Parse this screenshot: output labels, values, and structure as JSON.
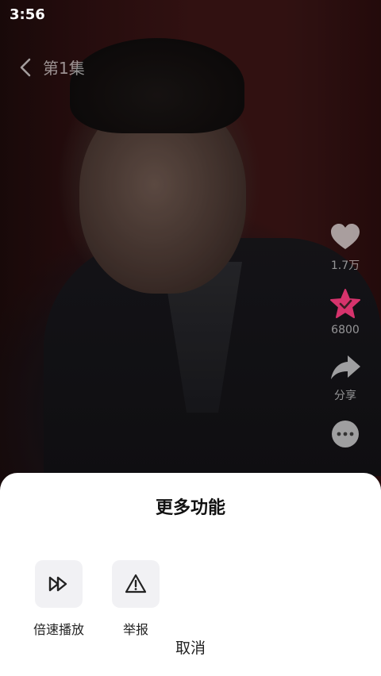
{
  "status_bar": {
    "time": "3:56"
  },
  "nav": {
    "episode_title": "第1集"
  },
  "side_actions": {
    "like": {
      "icon": "heart-icon",
      "count": "1.7万"
    },
    "favorite": {
      "icon": "star-check-icon",
      "count": "6800",
      "color": "#d6336c"
    },
    "share": {
      "icon": "share-arrow-icon",
      "label": "分享"
    },
    "more": {
      "icon": "more-dots-icon"
    }
  },
  "sheet": {
    "title": "更多功能",
    "options": [
      {
        "icon": "fast-forward-icon",
        "label": "倍速播放"
      },
      {
        "icon": "warning-icon",
        "label": "举报"
      }
    ],
    "cancel_label": "取消"
  }
}
